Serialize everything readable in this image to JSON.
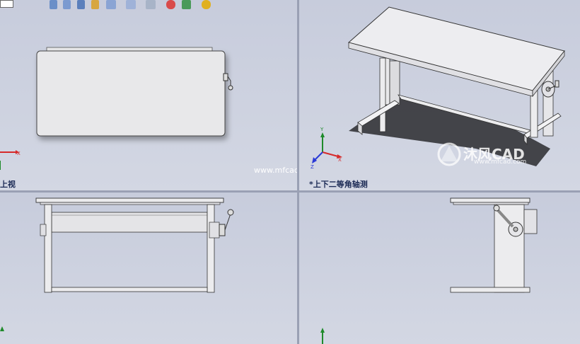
{
  "viewports": {
    "top_view_label": "上视",
    "iso_view_label": "*上下二等角轴测",
    "front_view_label": "",
    "right_view_label": ""
  },
  "watermark": {
    "site_url": "www.mfcad.com",
    "brand_name": "沐风CAD",
    "brand_url": "www.mfcad.com"
  },
  "toolbar": {
    "icons": [
      "zoom-to-fit-icon",
      "zoom-area-icon",
      "rotate-view-icon",
      "section-view-icon",
      "view-orientation-icon",
      "display-style-icon",
      "hide-show-icon",
      "edit-appearance-icon",
      "apply-scene-icon",
      "view-settings-icon"
    ]
  },
  "colors": {
    "viewport_bg": "#c9cedc",
    "part_fill": "#e8e8ea",
    "edge": "#2a2a2a",
    "axis_x": "#d62a2a",
    "axis_y": "#1e8a2a",
    "axis_z": "#2a3ad6",
    "label_text": "#1b2a55"
  }
}
